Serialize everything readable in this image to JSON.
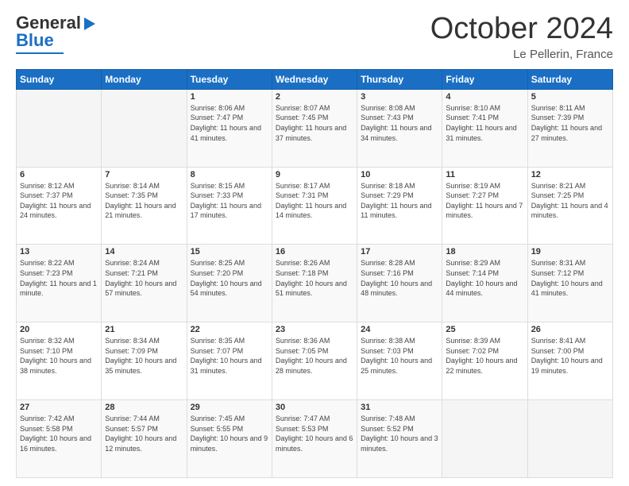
{
  "logo": {
    "text1": "General",
    "text2": "Blue"
  },
  "header": {
    "month": "October 2024",
    "location": "Le Pellerin, France"
  },
  "weekdays": [
    "Sunday",
    "Monday",
    "Tuesday",
    "Wednesday",
    "Thursday",
    "Friday",
    "Saturday"
  ],
  "weeks": [
    [
      {
        "day": "",
        "info": ""
      },
      {
        "day": "",
        "info": ""
      },
      {
        "day": "1",
        "info": "Sunrise: 8:06 AM\nSunset: 7:47 PM\nDaylight: 11 hours and 41 minutes."
      },
      {
        "day": "2",
        "info": "Sunrise: 8:07 AM\nSunset: 7:45 PM\nDaylight: 11 hours and 37 minutes."
      },
      {
        "day": "3",
        "info": "Sunrise: 8:08 AM\nSunset: 7:43 PM\nDaylight: 11 hours and 34 minutes."
      },
      {
        "day": "4",
        "info": "Sunrise: 8:10 AM\nSunset: 7:41 PM\nDaylight: 11 hours and 31 minutes."
      },
      {
        "day": "5",
        "info": "Sunrise: 8:11 AM\nSunset: 7:39 PM\nDaylight: 11 hours and 27 minutes."
      }
    ],
    [
      {
        "day": "6",
        "info": "Sunrise: 8:12 AM\nSunset: 7:37 PM\nDaylight: 11 hours and 24 minutes."
      },
      {
        "day": "7",
        "info": "Sunrise: 8:14 AM\nSunset: 7:35 PM\nDaylight: 11 hours and 21 minutes."
      },
      {
        "day": "8",
        "info": "Sunrise: 8:15 AM\nSunset: 7:33 PM\nDaylight: 11 hours and 17 minutes."
      },
      {
        "day": "9",
        "info": "Sunrise: 8:17 AM\nSunset: 7:31 PM\nDaylight: 11 hours and 14 minutes."
      },
      {
        "day": "10",
        "info": "Sunrise: 8:18 AM\nSunset: 7:29 PM\nDaylight: 11 hours and 11 minutes."
      },
      {
        "day": "11",
        "info": "Sunrise: 8:19 AM\nSunset: 7:27 PM\nDaylight: 11 hours and 7 minutes."
      },
      {
        "day": "12",
        "info": "Sunrise: 8:21 AM\nSunset: 7:25 PM\nDaylight: 11 hours and 4 minutes."
      }
    ],
    [
      {
        "day": "13",
        "info": "Sunrise: 8:22 AM\nSunset: 7:23 PM\nDaylight: 11 hours and 1 minute."
      },
      {
        "day": "14",
        "info": "Sunrise: 8:24 AM\nSunset: 7:21 PM\nDaylight: 10 hours and 57 minutes."
      },
      {
        "day": "15",
        "info": "Sunrise: 8:25 AM\nSunset: 7:20 PM\nDaylight: 10 hours and 54 minutes."
      },
      {
        "day": "16",
        "info": "Sunrise: 8:26 AM\nSunset: 7:18 PM\nDaylight: 10 hours and 51 minutes."
      },
      {
        "day": "17",
        "info": "Sunrise: 8:28 AM\nSunset: 7:16 PM\nDaylight: 10 hours and 48 minutes."
      },
      {
        "day": "18",
        "info": "Sunrise: 8:29 AM\nSunset: 7:14 PM\nDaylight: 10 hours and 44 minutes."
      },
      {
        "day": "19",
        "info": "Sunrise: 8:31 AM\nSunset: 7:12 PM\nDaylight: 10 hours and 41 minutes."
      }
    ],
    [
      {
        "day": "20",
        "info": "Sunrise: 8:32 AM\nSunset: 7:10 PM\nDaylight: 10 hours and 38 minutes."
      },
      {
        "day": "21",
        "info": "Sunrise: 8:34 AM\nSunset: 7:09 PM\nDaylight: 10 hours and 35 minutes."
      },
      {
        "day": "22",
        "info": "Sunrise: 8:35 AM\nSunset: 7:07 PM\nDaylight: 10 hours and 31 minutes."
      },
      {
        "day": "23",
        "info": "Sunrise: 8:36 AM\nSunset: 7:05 PM\nDaylight: 10 hours and 28 minutes."
      },
      {
        "day": "24",
        "info": "Sunrise: 8:38 AM\nSunset: 7:03 PM\nDaylight: 10 hours and 25 minutes."
      },
      {
        "day": "25",
        "info": "Sunrise: 8:39 AM\nSunset: 7:02 PM\nDaylight: 10 hours and 22 minutes."
      },
      {
        "day": "26",
        "info": "Sunrise: 8:41 AM\nSunset: 7:00 PM\nDaylight: 10 hours and 19 minutes."
      }
    ],
    [
      {
        "day": "27",
        "info": "Sunrise: 7:42 AM\nSunset: 5:58 PM\nDaylight: 10 hours and 16 minutes."
      },
      {
        "day": "28",
        "info": "Sunrise: 7:44 AM\nSunset: 5:57 PM\nDaylight: 10 hours and 12 minutes."
      },
      {
        "day": "29",
        "info": "Sunrise: 7:45 AM\nSunset: 5:55 PM\nDaylight: 10 hours and 9 minutes."
      },
      {
        "day": "30",
        "info": "Sunrise: 7:47 AM\nSunset: 5:53 PM\nDaylight: 10 hours and 6 minutes."
      },
      {
        "day": "31",
        "info": "Sunrise: 7:48 AM\nSunset: 5:52 PM\nDaylight: 10 hours and 3 minutes."
      },
      {
        "day": "",
        "info": ""
      },
      {
        "day": "",
        "info": ""
      }
    ]
  ]
}
